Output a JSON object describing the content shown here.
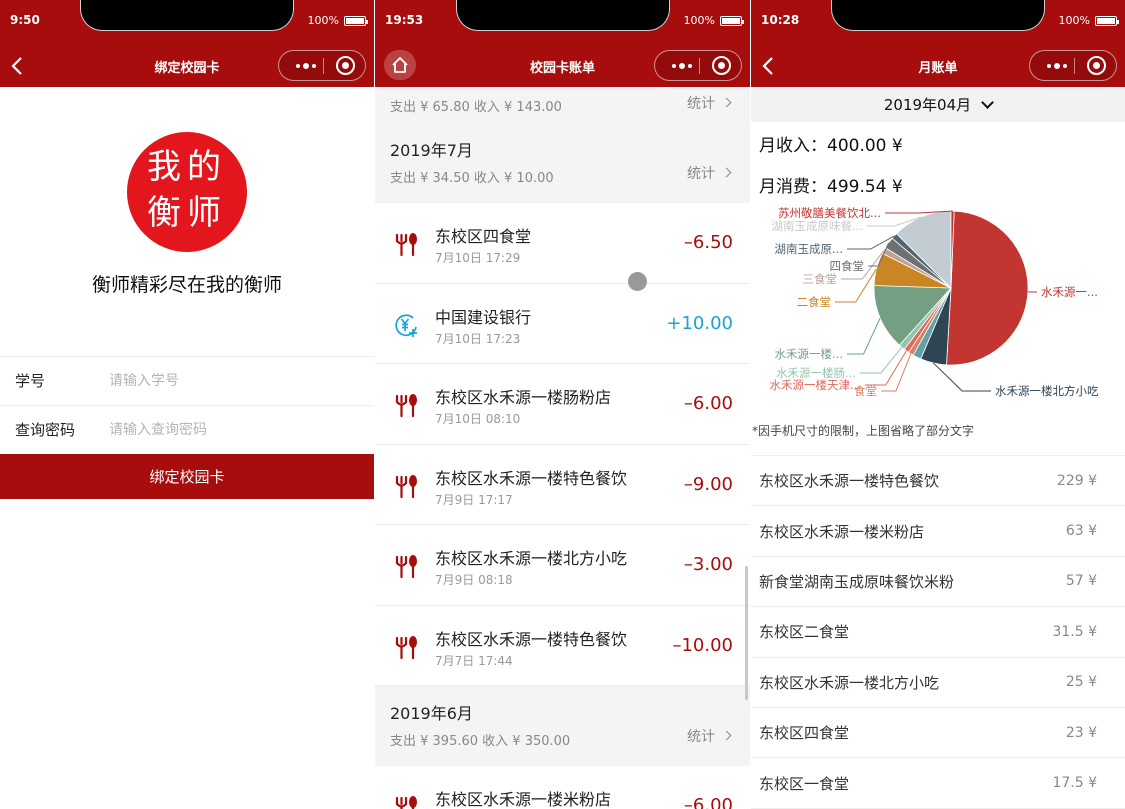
{
  "screens": {
    "bind": {
      "status": {
        "time": "9:50",
        "battery": "100%"
      },
      "title": "绑定校园卡",
      "logo": {
        "line1": "我的",
        "line2": "衡师"
      },
      "slogan": "衡师精彩尽在我的衡师",
      "fields": [
        {
          "label": "学号",
          "placeholder": "请输入学号"
        },
        {
          "label": "查询密码",
          "placeholder": "请输入查询密码"
        }
      ],
      "submit_label": "绑定校园卡"
    },
    "bill": {
      "status": {
        "time": "19:53",
        "battery": "100%"
      },
      "title": "校园卡账单",
      "top_summary": {
        "text": "支出 ¥ 65.80  收入 ¥ 143.00",
        "stat": "统计"
      },
      "months": [
        {
          "title": "2019年7月",
          "summary": "支出 ¥ 34.50  收入 ¥ 10.00",
          "stat": "统计",
          "items": [
            {
              "icon": "fork-spoon-icon",
              "name": "东校区四食堂",
              "time": "7月10日  17:29",
              "amount": "–6.50",
              "kind": "neg"
            },
            {
              "icon": "yuan-plus-icon",
              "name": "中国建设银行",
              "time": "7月10日  17:23",
              "amount": "+10.00",
              "kind": "pos"
            },
            {
              "icon": "fork-spoon-icon",
              "name": "东校区水禾源一楼肠粉店",
              "time": "7月10日  08:10",
              "amount": "–6.00",
              "kind": "neg"
            },
            {
              "icon": "fork-spoon-icon",
              "name": "东校区水禾源一楼特色餐饮",
              "time": "7月9日  17:17",
              "amount": "–9.00",
              "kind": "neg"
            },
            {
              "icon": "fork-spoon-icon",
              "name": "东校区水禾源一楼北方小吃",
              "time": "7月9日  08:18",
              "amount": "–3.00",
              "kind": "neg"
            },
            {
              "icon": "fork-spoon-icon",
              "name": "东校区水禾源一楼特色餐饮",
              "time": "7月7日  17:44",
              "amount": "–10.00",
              "kind": "neg"
            }
          ]
        },
        {
          "title": "2019年6月",
          "summary": "支出 ¥ 395.60  收入 ¥ 350.00",
          "stat": "统计",
          "items": [
            {
              "icon": "fork-spoon-icon",
              "name": "东校区水禾源一楼米粉店",
              "time": "",
              "amount": "–6.00",
              "kind": "neg"
            }
          ]
        }
      ]
    },
    "monthly": {
      "status": {
        "time": "10:28",
        "battery": "100%"
      },
      "title": "月账单",
      "month": "2019年04月",
      "income": "月收入：400.00 ¥",
      "expense": "月消费：499.54 ¥",
      "note": "*因手机尺寸的限制，上图省略了部分文字",
      "ranking": [
        {
          "name": "东校区水禾源一楼特色餐饮",
          "value": "229 ¥"
        },
        {
          "name": "东校区水禾源一楼米粉店",
          "value": "63 ¥"
        },
        {
          "name": "新食堂湖南玉成原味餐饮米粉",
          "value": "57 ¥"
        },
        {
          "name": "东校区二食堂",
          "value": "31.5 ¥"
        },
        {
          "name": "东校区水禾源一楼北方小吃",
          "value": "25 ¥"
        },
        {
          "name": "东校区四食堂",
          "value": "23 ¥"
        },
        {
          "name": "东校区一食堂",
          "value": "17.5 ¥"
        }
      ]
    }
  },
  "chart_data": {
    "type": "pie",
    "slices": [
      {
        "label": "水禾源一...",
        "value": 229,
        "color": "#c23531"
      },
      {
        "label": "水禾源一楼北方小吃",
        "value": 25,
        "color": "#2f4554"
      },
      {
        "label": "",
        "value": 8,
        "color": "#61a0a8"
      },
      {
        "label": "食堂",
        "value": 5,
        "color": "#d48265"
      },
      {
        "label": "水禾源一楼天津...",
        "value": 5,
        "color": "#e0685c"
      },
      {
        "label": "水禾源一楼肠...",
        "value": 6,
        "color": "#91c7ae"
      },
      {
        "label": "水禾源一楼...",
        "value": 63,
        "color": "#749f83"
      },
      {
        "label": "二食堂",
        "value": 31.5,
        "color": "#ca8622"
      },
      {
        "label": "三食堂",
        "value": 6,
        "color": "#bda29a"
      },
      {
        "label": "四食堂",
        "value": 11,
        "color": "#6e7074"
      },
      {
        "label": "湖南玉成原...",
        "value": 6,
        "color": "#546570"
      },
      {
        "label": "湖南玉成原味餐...",
        "value": 57,
        "color": "#c4ccd3"
      },
      {
        "label": "苏州敬膳美餐饮北...",
        "value": 3,
        "color": "#c23531"
      }
    ]
  }
}
